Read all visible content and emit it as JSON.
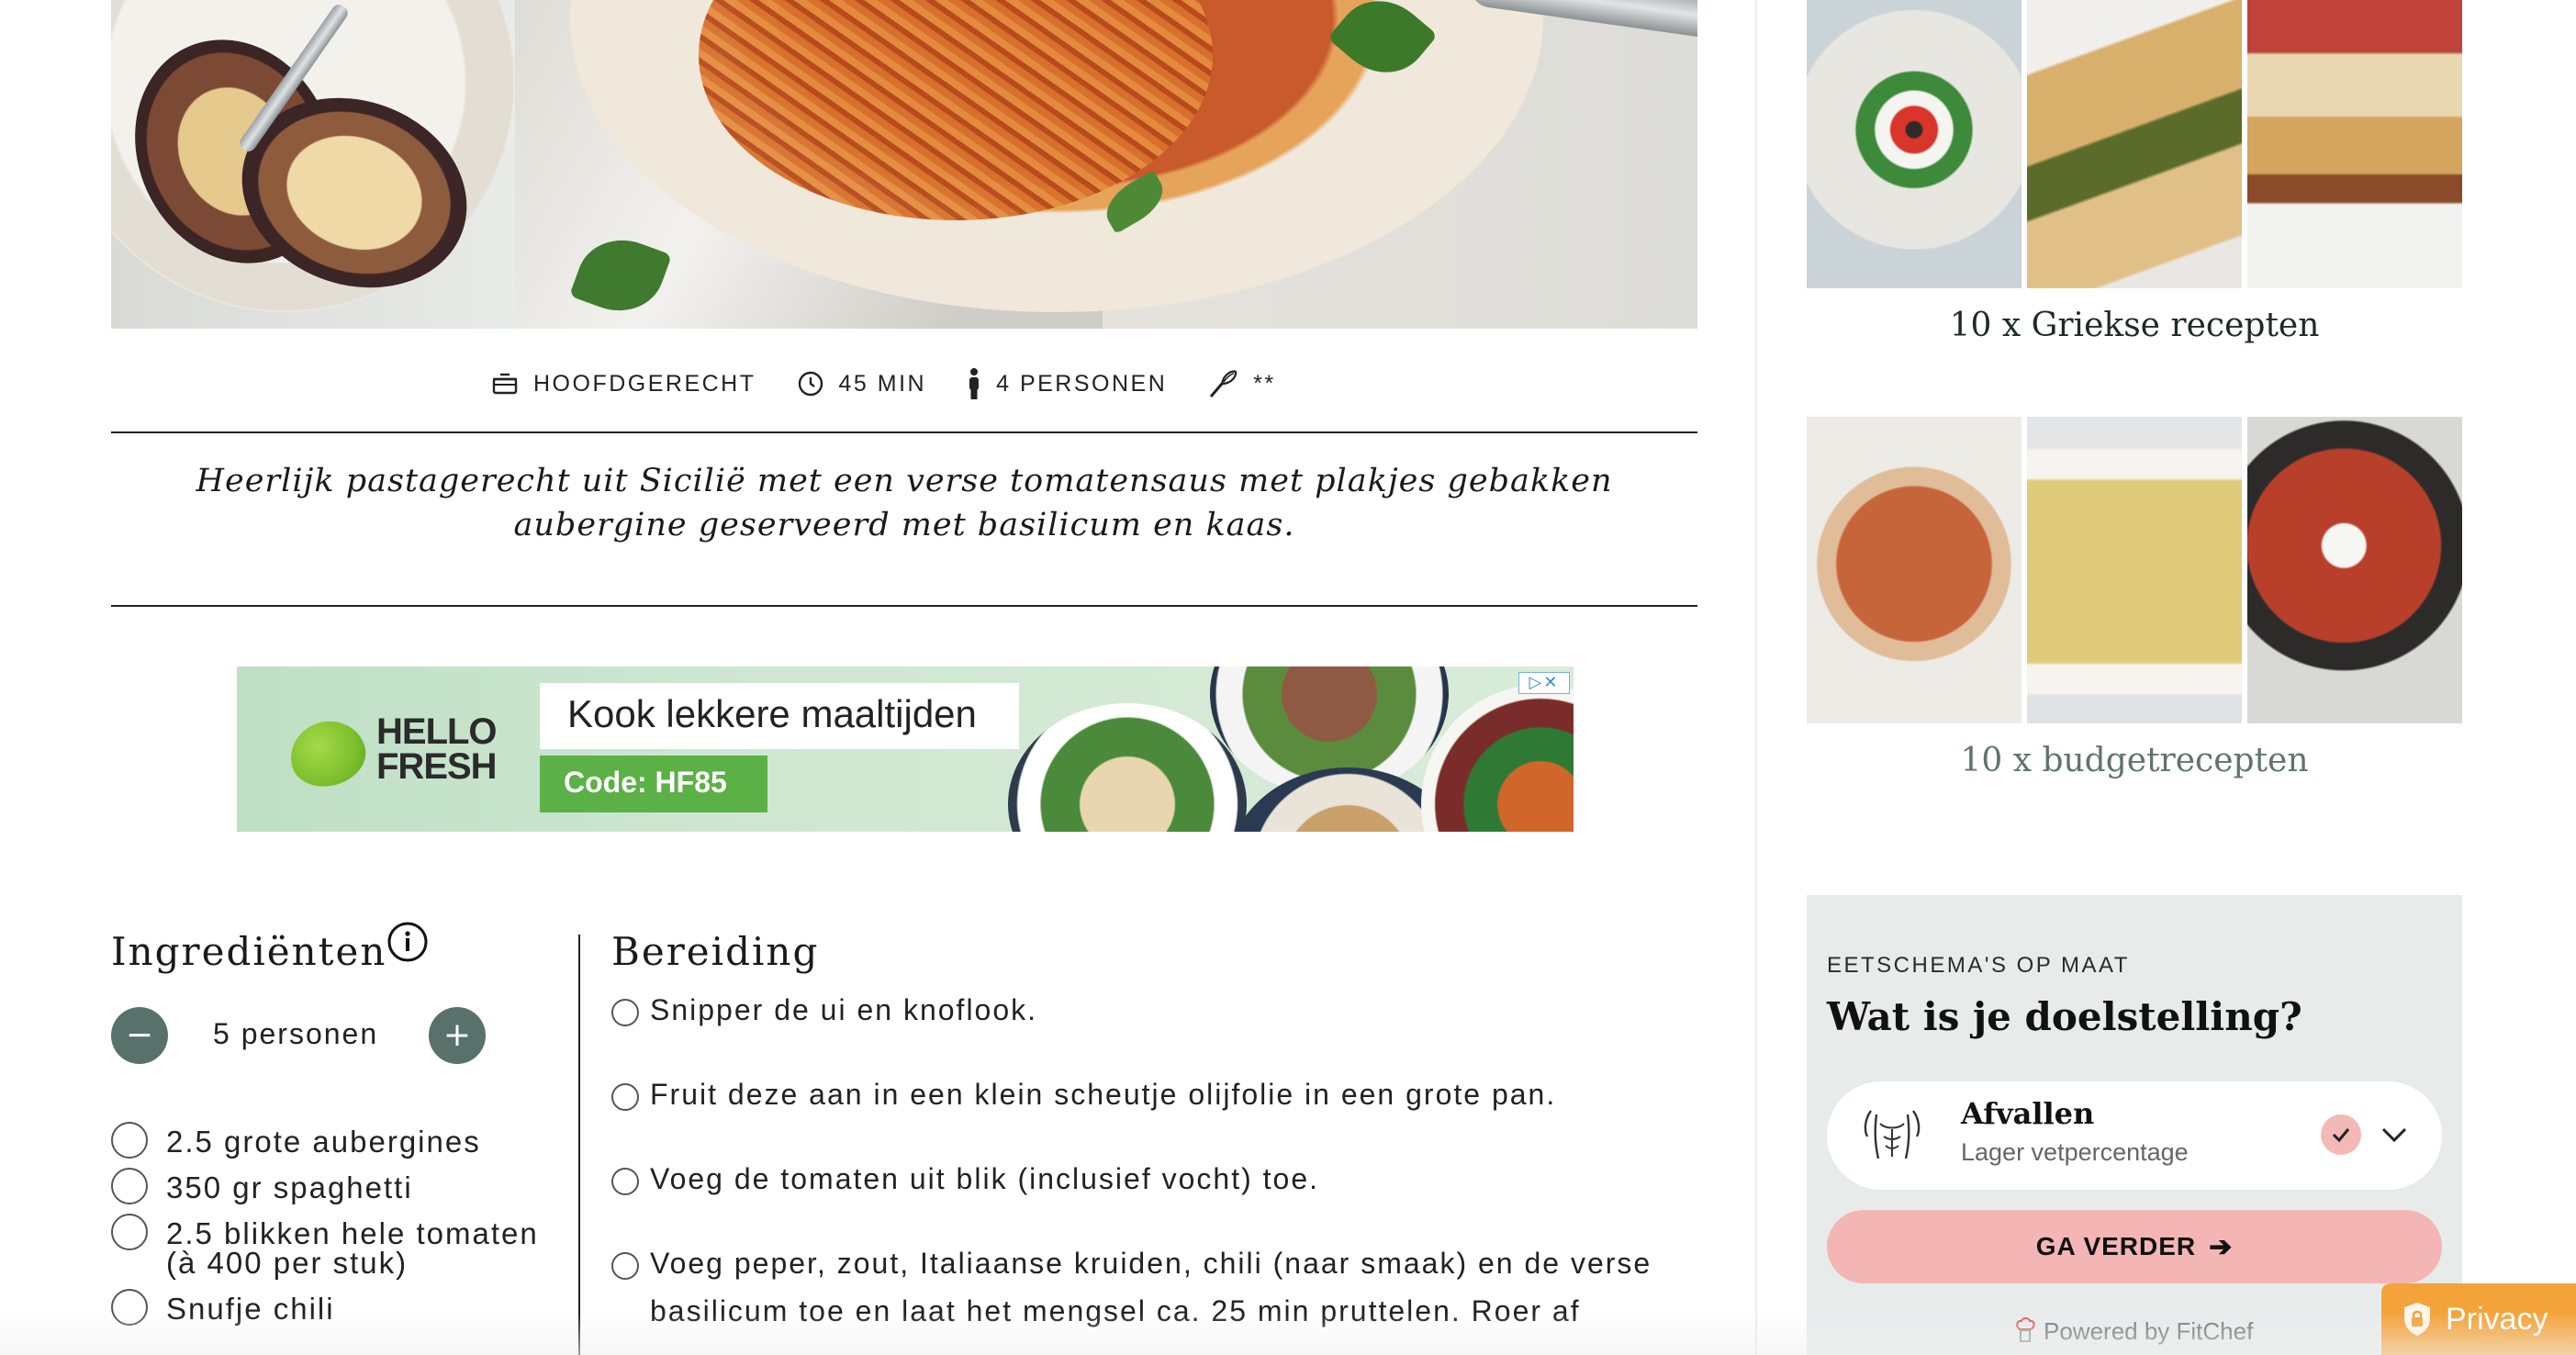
{
  "recipe": {
    "meta": [
      {
        "icon": "pot-icon",
        "label": "HOOFDGERECHT"
      },
      {
        "icon": "clock-icon",
        "label": "45 MIN"
      },
      {
        "icon": "person-icon",
        "label": "4 PERSONEN"
      },
      {
        "icon": "whisk-icon",
        "label": "**"
      }
    ],
    "intro": "Heerlijk pastagerecht uit Sicilië met een verse tomatensaus met plakjes gebakken aubergine geserveerd met basilicum en kaas."
  },
  "ad": {
    "brand_line1": "HELLO",
    "brand_line2": "FRESH",
    "headline": "Kook lekkere maaltijden",
    "code": "Code: HF85",
    "ad_choices": "▷✕"
  },
  "ingredients": {
    "title": "Ingrediënten",
    "persons": "5 personen",
    "minus_label": "−",
    "plus_label": "+",
    "items": [
      "2.5 grote aubergines",
      "350 gr spaghetti",
      "2.5 blikken hele tomaten (à 400 per stuk)",
      "Snufje chili"
    ]
  },
  "preparation": {
    "title": "Bereiding",
    "steps": [
      "Snipper de ui en knoflook.",
      "Fruit deze aan in een klein scheutje olijfolie in een grote pan.",
      "Voeg de tomaten uit blik (inclusief vocht) toe.",
      "Voeg peper, zout, Italiaanse kruiden, chili (naar smaak) en de verse basilicum toe en laat het mengsel ca. 25 min pruttelen. Roer af"
    ]
  },
  "sidebar": {
    "collections": [
      {
        "caption": "10 x Griekse recepten"
      },
      {
        "caption": "10 x budgetrecepten"
      }
    ],
    "fitchef": {
      "kicker": "EETSCHEMA'S OP MAAT",
      "title": "Wat is je doelstelling?",
      "option": "Afvallen",
      "option_sub": "Lager vetpercentage",
      "button": "GA VERDER",
      "powered": "Powered by FitChef"
    },
    "privacy": "Privacy"
  },
  "colors": {
    "stepper": "#58716a",
    "fitchef_bg": "#e7eceb",
    "cta": "#f4b6b4",
    "privacy": "#f4a33a",
    "ad_code": "#5bb046"
  }
}
